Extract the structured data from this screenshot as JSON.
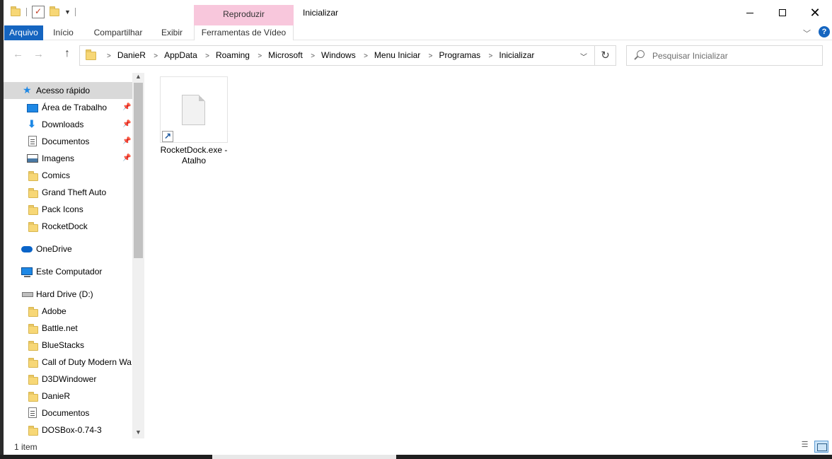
{
  "window": {
    "title": "Inicializar",
    "contextual_tab_header": "Reproduzir",
    "close_glyph": "✕"
  },
  "ribbon": {
    "tabs": [
      {
        "label": "Arquivo"
      },
      {
        "label": "Início"
      },
      {
        "label": "Compartilhar"
      },
      {
        "label": "Exibir"
      },
      {
        "label": "Ferramentas de Vídeo"
      }
    ],
    "help_glyph": "?"
  },
  "address": {
    "breadcrumb": [
      "DanieR",
      "AppData",
      "Roaming",
      "Microsoft",
      "Windows",
      "Menu Iniciar",
      "Programas",
      "Inicializar"
    ]
  },
  "search": {
    "placeholder": "Pesquisar Inicializar"
  },
  "nav_pane": {
    "quick_access": {
      "label": "Acesso rápido",
      "items": [
        {
          "label": "Área de Trabalho",
          "icon": "desktop-icon",
          "pinned": true
        },
        {
          "label": "Downloads",
          "icon": "download-icon",
          "pinned": true
        },
        {
          "label": "Documentos",
          "icon": "document-icon",
          "pinned": true
        },
        {
          "label": "Imagens",
          "icon": "pictures-icon",
          "pinned": true
        },
        {
          "label": "Comics",
          "icon": "folder-icon",
          "pinned": false
        },
        {
          "label": "Grand Theft Auto",
          "icon": "folder-icon",
          "pinned": false
        },
        {
          "label": "Pack Icons",
          "icon": "folder-icon",
          "pinned": false
        },
        {
          "label": "RocketDock",
          "icon": "folder-icon",
          "pinned": false
        }
      ]
    },
    "onedrive": {
      "label": "OneDrive"
    },
    "this_pc": {
      "label": "Este Computador"
    },
    "drive": {
      "label": "Hard Drive (D:)",
      "items": [
        {
          "label": "Adobe",
          "icon": "folder-icon"
        },
        {
          "label": "Battle.net",
          "icon": "folder-icon"
        },
        {
          "label": "BlueStacks",
          "icon": "folder-icon"
        },
        {
          "label": "Call of Duty Modern Wa",
          "icon": "folder-icon"
        },
        {
          "label": "D3DWindower",
          "icon": "folder-icon"
        },
        {
          "label": "DanieR",
          "icon": "folder-icon"
        },
        {
          "label": "Documentos",
          "icon": "document-icon"
        },
        {
          "label": "DOSBox-0.74-3",
          "icon": "folder-icon"
        }
      ]
    }
  },
  "content": {
    "files": [
      {
        "name": "RocketDock.exe - Atalho",
        "icon": "shortcut-file-icon"
      }
    ]
  },
  "status": {
    "item_count": "1 item"
  },
  "colors": {
    "accent": "#1565c0",
    "contextual_tab": "#f8c7dc",
    "selection": "#d9d9d9"
  }
}
